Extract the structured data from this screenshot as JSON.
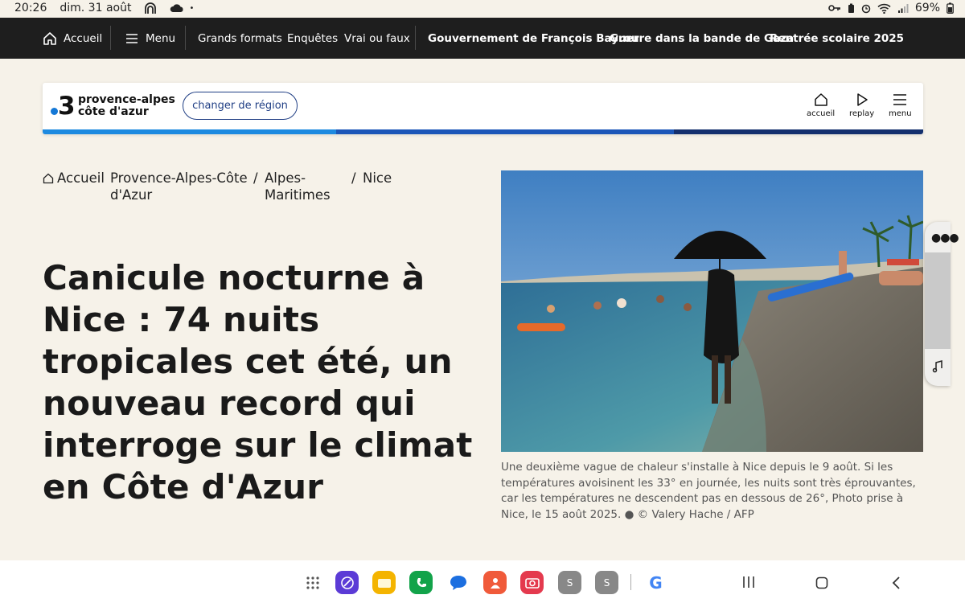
{
  "status_bar": {
    "time": "20:26",
    "date": "dim. 31 août",
    "battery": "69%"
  },
  "top_nav": {
    "home_label": "Accueil",
    "menu_label": "Menu",
    "links": [
      "Grands formats",
      "Enquêtes",
      "Vrai ou faux"
    ],
    "topics": [
      "Gouvernement de François Bayrou",
      "Guerre dans la bande de Gaza",
      "Rentrée scolaire 2025"
    ]
  },
  "region_header": {
    "logo_number": "3",
    "logo_line1": "provence-alpes",
    "logo_line2": "côte d'azur",
    "change_region_label": "changer de région",
    "actions": [
      "accueil",
      "replay",
      "menu"
    ]
  },
  "breadcrumb": {
    "home": "Accueil",
    "level1": "Provence-Alpes-Côte d'Azur",
    "level2": "Alpes-Maritimes",
    "level3": "Nice"
  },
  "article": {
    "headline": "Canicule nocturne à Nice : 74 nuits tropicales cet été, un nouveau record qui interroge sur le climat en Côte d'Azur",
    "caption": "Une deuxième vague de chaleur s'installe à Nice depuis le 9 août. Si les températures avoisinent les 33° en journée, les nuits sont très éprouvantes, car les températures ne descendent pas en dessous de 26°, Photo prise à Nice, le 15 août 2025. ● © Valery Hache / AFP"
  },
  "colors": {
    "nav_bg": "#1e1e1e",
    "page_bg": "#f6f2e9",
    "accent_blue": "#1478d6",
    "dark_blue": "#1f3e84"
  },
  "dock": {
    "apps": [
      "menu-grid-icon",
      "browser-icon",
      "files-icon",
      "phone-icon",
      "messages-icon",
      "contacts-icon",
      "camera-icon",
      "s-app-icon",
      "s-app-icon",
      "google-icon"
    ],
    "s_label": "S",
    "google_label": "G"
  }
}
